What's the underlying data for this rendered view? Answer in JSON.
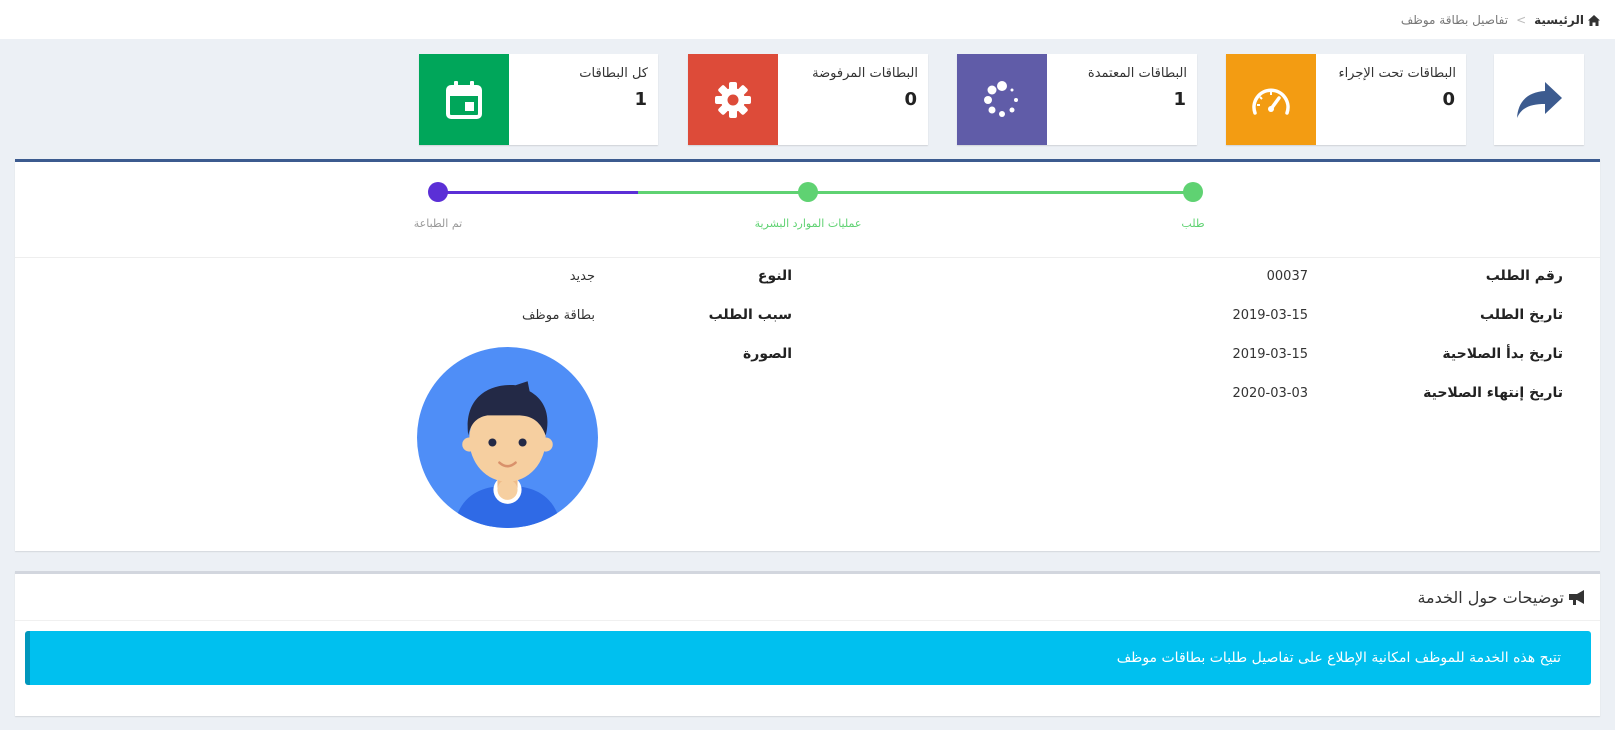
{
  "breadcrumb": {
    "home": "الرئيسية",
    "separator": ">",
    "current": "تفاصيل بطاقة موظف"
  },
  "back": {
    "icon": "share-arrow-icon"
  },
  "stats": [
    {
      "label": "البطاقات تحت الإجراء",
      "count": "0",
      "color": "#f39c12",
      "icon": "speedometer-icon"
    },
    {
      "label": "البطاقات المعتمدة",
      "count": "1",
      "color": "#605ca8",
      "icon": "spinner-icon"
    },
    {
      "label": "البطاقات المرفوضة",
      "count": "0",
      "color": "#dd4b39",
      "icon": "gear-icon"
    },
    {
      "label": "كل البطاقات",
      "count": "1",
      "color": "#00a65a",
      "icon": "calendar-icon"
    }
  ],
  "progress": {
    "steps": [
      {
        "label": "طلب",
        "status": "done",
        "color": "#5fd272"
      },
      {
        "label": "عمليات الموارد البشرية",
        "status": "done",
        "color": "#5fd272"
      },
      {
        "label": "تم الطباعة",
        "status": "current",
        "color": "#5b2fd6"
      }
    ]
  },
  "details": {
    "request_number": {
      "label": "رقم الطلب",
      "value": "00037"
    },
    "request_date": {
      "label": "تاريخ الطلب",
      "value": "2019-03-15"
    },
    "valid_from": {
      "label": "تاريخ بدأ الصلاحية",
      "value": "2019-03-15"
    },
    "valid_to": {
      "label": "تاريخ إنتهاء الصلاحية",
      "value": "2020-03-03"
    },
    "type": {
      "label": "النوع",
      "value": "جديد"
    },
    "reason": {
      "label": "سبب الطلب",
      "value": "بطاقة موظف"
    },
    "photo": {
      "label": "الصورة"
    }
  },
  "info": {
    "title": "توضيحات حول الخدمة",
    "icon": "megaphone-icon",
    "message": "تتيح هذه الخدمة للموظف امكانية الإطلاع على تفاصيل طلبات بطاقات موظف"
  }
}
